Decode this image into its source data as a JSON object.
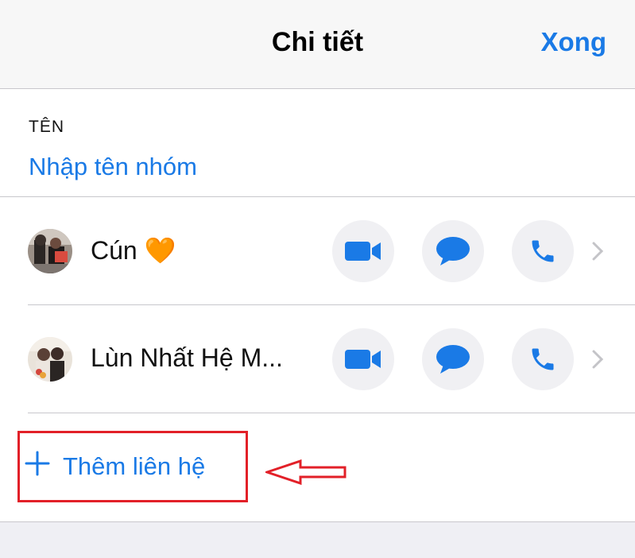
{
  "header": {
    "title": "Chi tiết",
    "done_label": "Xong"
  },
  "name_section": {
    "label": "TÊN",
    "placeholder": "Nhập tên nhóm"
  },
  "contacts": [
    {
      "name": "Cún",
      "emoji": "🧡"
    },
    {
      "name": "Lùn Nhất Hệ M..."
    }
  ],
  "add_contact": {
    "label": "Thêm liên hệ"
  },
  "colors": {
    "accent": "#1a7ae6",
    "highlight": "#e22028",
    "action_bg": "#f0f0f3"
  },
  "icons": [
    "video-call-icon",
    "message-icon",
    "phone-icon",
    "chevron-right-icon",
    "plus-icon",
    "arrow-left-icon"
  ]
}
